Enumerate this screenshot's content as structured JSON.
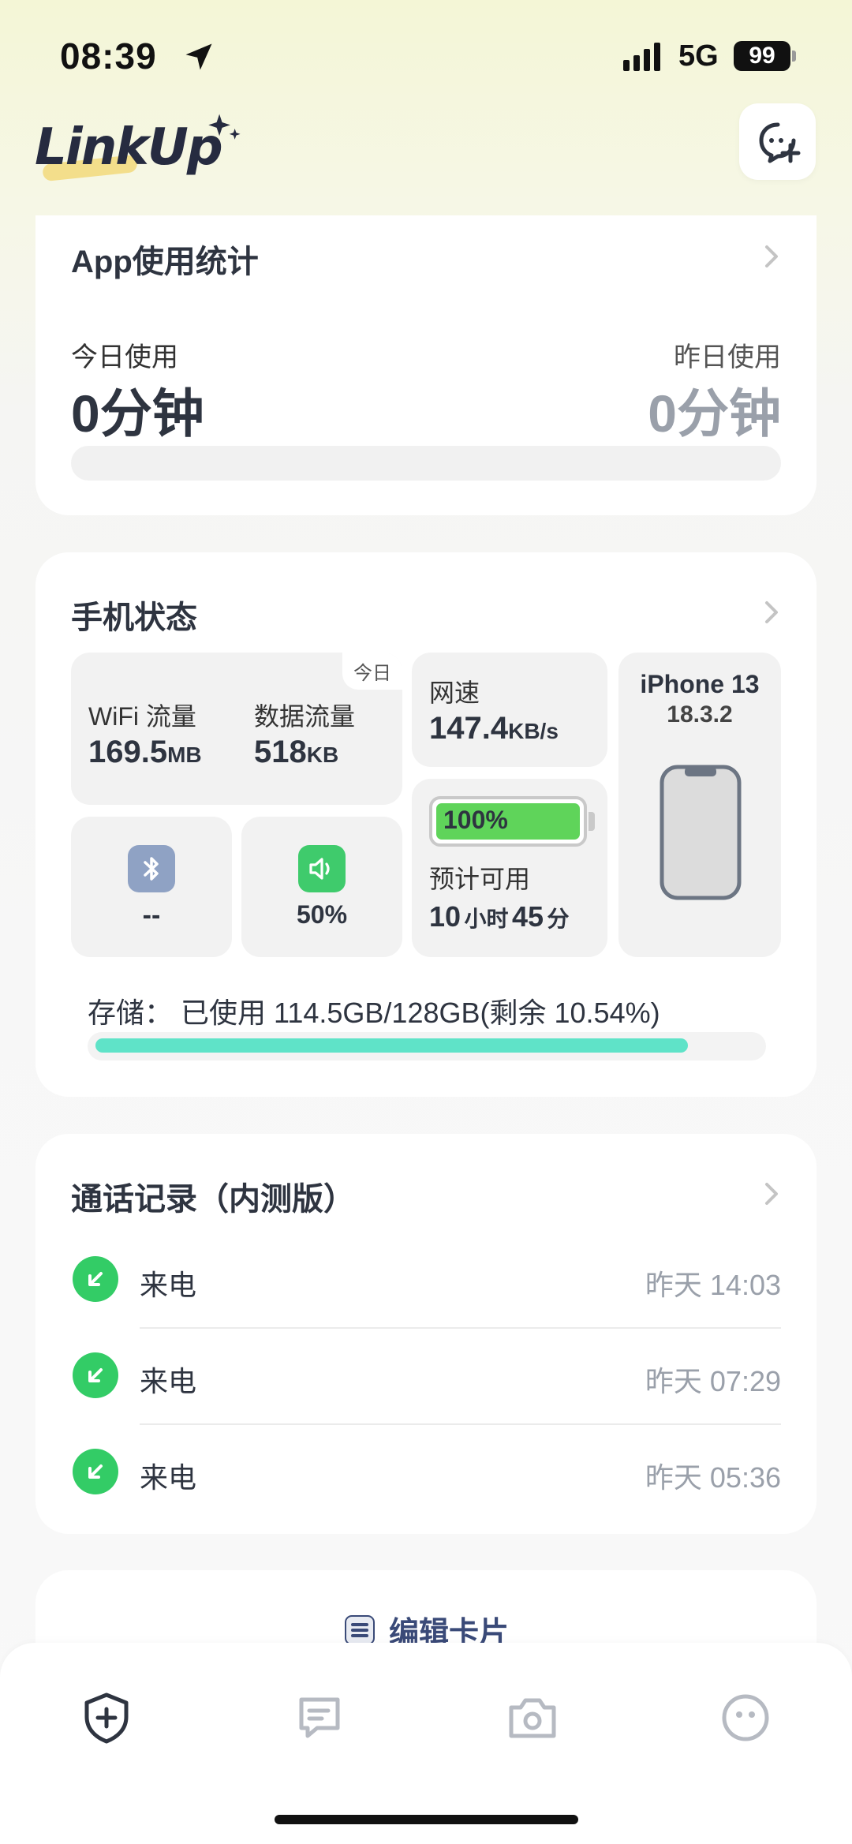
{
  "status_bar": {
    "time": "08:39",
    "network": "5G",
    "battery": "99"
  },
  "header": {
    "logo": "LinkUp"
  },
  "app_usage": {
    "title": "App使用统计",
    "today_label": "今日使用",
    "today_value": "0分钟",
    "yesterday_label": "昨日使用",
    "yesterday_value": "0分钟"
  },
  "phone_status": {
    "title": "手机状态",
    "today_tag": "今日",
    "wifi_label": "WiFi 流量",
    "wifi_value": "169.5",
    "wifi_unit": "MB",
    "data_label": "数据流量",
    "data_value": "518",
    "data_unit": "KB",
    "speed_label": "网速",
    "speed_value": "147.4",
    "speed_unit": "KB/s",
    "device_name": "iPhone 13",
    "os_version": "18.3.2",
    "bluetooth_value": "--",
    "volume_value": "50%",
    "battery_percent_text": "100%",
    "battery_level": 1.0,
    "estimate_label": "预计可用",
    "estimate_hours": "10",
    "hours_unit": "小时",
    "estimate_minutes": "45",
    "minutes_unit": "分",
    "storage_text": "存储： 已使用 114.5GB/128GB(剩余 10.54%)",
    "storage_used_fraction": 0.8946,
    "colors": {
      "battery": "#5fd45a",
      "storage": "#5fe3c8",
      "bluetooth": "#8fa2c4",
      "volume": "#3fcb6c"
    }
  },
  "call_log": {
    "title": "通话记录（内测版）",
    "items": [
      {
        "type": "来电",
        "time": "昨天 14:03"
      },
      {
        "type": "来电",
        "time": "昨天 07:29"
      },
      {
        "type": "来电",
        "time": "昨天 05:36"
      }
    ]
  },
  "edit_card": {
    "label": "编辑卡片"
  },
  "bottom_nav": [
    "home-add-icon",
    "chat-icon",
    "camera-icon",
    "face-icon"
  ]
}
